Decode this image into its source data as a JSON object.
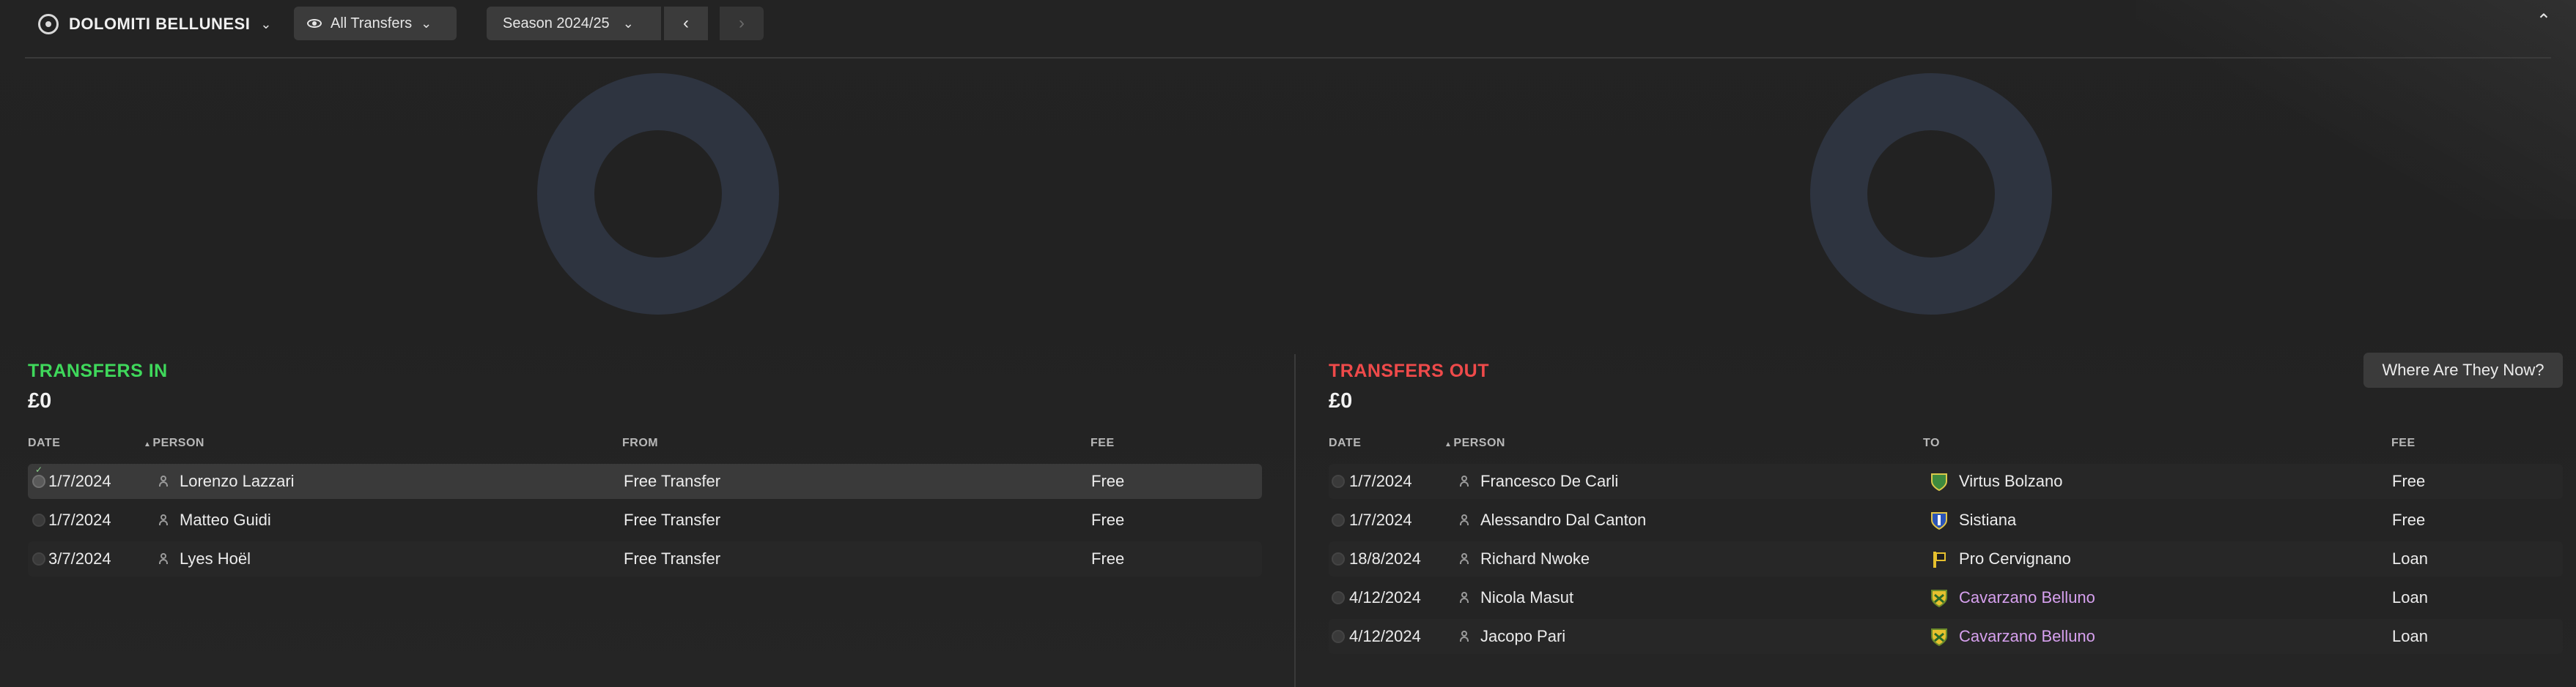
{
  "header": {
    "club_name": "DOLOMITI BELLUNESI",
    "filter_label": "All Transfers",
    "season_label": "Season 2024/25",
    "prev_glyph": "‹",
    "next_glyph": "›",
    "collapse_glyph": "⌃",
    "chevron_glyph": "⌄"
  },
  "icons": {
    "club": "club-badge-icon",
    "filter": "eye-icon",
    "person": "person-icon",
    "status": "status-dot-icon"
  },
  "colors": {
    "in_accent": "#3fd85b",
    "out_accent": "#ef4a4a",
    "donut": "#2e3440",
    "loan_club_link": "#d6a0ee"
  },
  "transfers_in": {
    "title": "TRANSFERS IN",
    "total": "£0",
    "columns": {
      "date": "DATE",
      "person": "PERSON",
      "from": "FROM",
      "fee": "FEE"
    },
    "rows": [
      {
        "date": "1/7/2024",
        "person": "Lorenzo Lazzari",
        "from": "Free Transfer",
        "fee": "Free",
        "confirmed": true
      },
      {
        "date": "1/7/2024",
        "person": "Matteo Guidi",
        "from": "Free Transfer",
        "fee": "Free",
        "confirmed": false
      },
      {
        "date": "3/7/2024",
        "person": "Lyes Hoël",
        "from": "Free Transfer",
        "fee": "Free",
        "confirmed": false
      }
    ]
  },
  "transfers_out": {
    "title": "TRANSFERS OUT",
    "total": "£0",
    "where_button": "Where Are They Now?",
    "columns": {
      "date": "DATE",
      "person": "PERSON",
      "to": "TO",
      "fee": "FEE"
    },
    "rows": [
      {
        "date": "1/7/2024",
        "person": "Francesco De Carli",
        "to": "Virtus Bolzano",
        "fee": "Free",
        "crest": "green-shield"
      },
      {
        "date": "1/7/2024",
        "person": "Alessandro Dal Canton",
        "to": "Sistiana",
        "fee": "Free",
        "crest": "blue-shield"
      },
      {
        "date": "18/8/2024",
        "person": "Richard Nwoke",
        "to": "Pro Cervignano",
        "fee": "Loan",
        "crest": "yellow-flag"
      },
      {
        "date": "4/12/2024",
        "person": "Nicola Masut",
        "to": "Cavarzano Belluno",
        "fee": "Loan",
        "crest": "yellow-shield",
        "highlight": true
      },
      {
        "date": "4/12/2024",
        "person": "Jacopo Pari",
        "to": "Cavarzano Belluno",
        "fee": "Loan",
        "crest": "yellow-shield",
        "highlight": true
      }
    ]
  }
}
